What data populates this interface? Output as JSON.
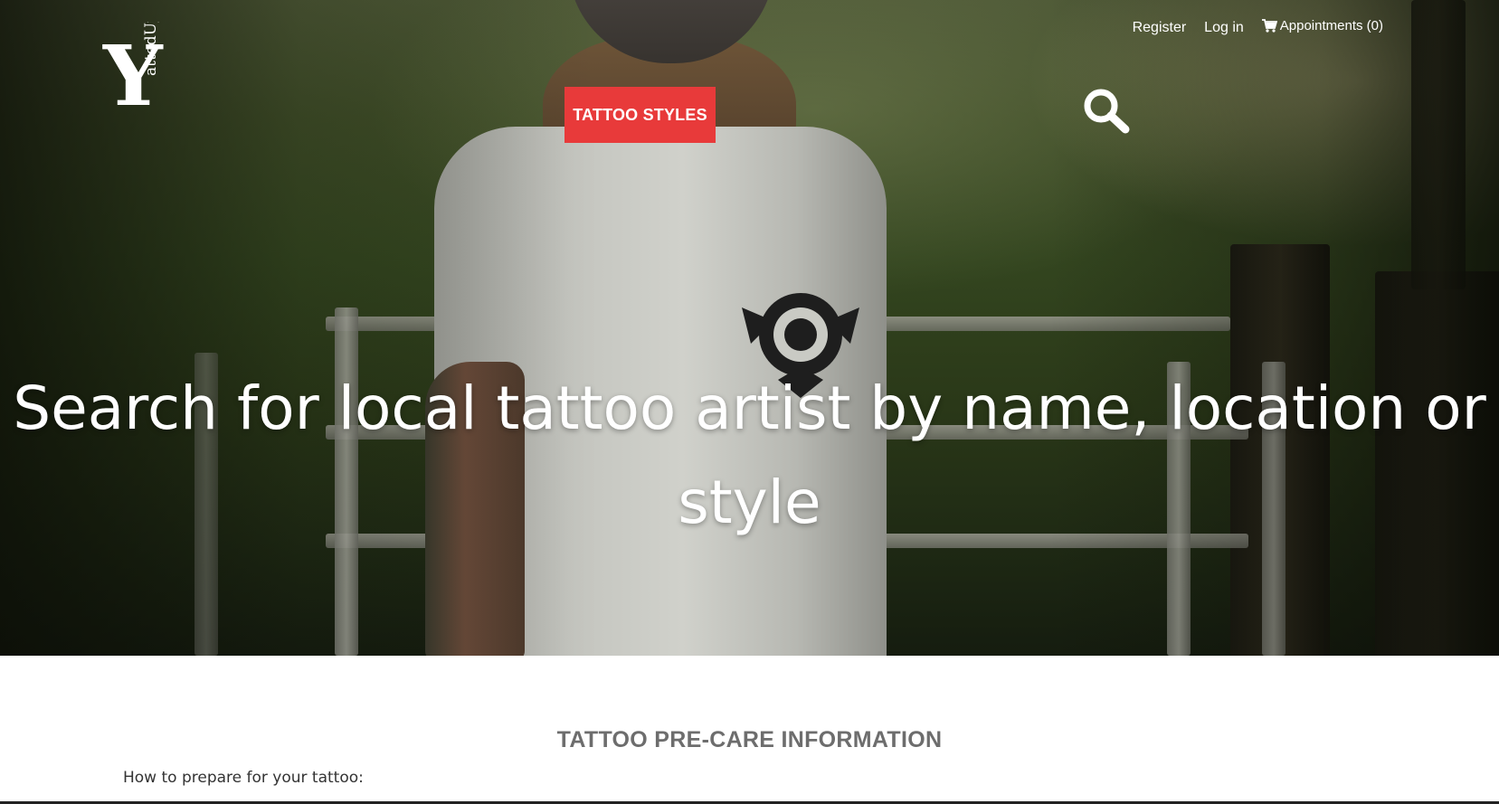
{
  "brand": {
    "logo_text": "Y",
    "logo_subtext": "attedUp"
  },
  "nav": {
    "register_label": "Register",
    "login_label": "Log in",
    "appointments_label": "Appointments (0)",
    "cart_icon": "cart-icon",
    "styles_button_label": "TATTOO STYLES",
    "search_icon": "search-icon"
  },
  "hero": {
    "headline": "Search for local tattoo artist by name, location or style"
  },
  "content": {
    "section_title": "TATTOO PRE-CARE INFORMATION",
    "section_subtitle": "How to prepare for your tattoo:"
  },
  "colors": {
    "accent": "#e83a3a",
    "title_gray": "#6d6d6d"
  }
}
